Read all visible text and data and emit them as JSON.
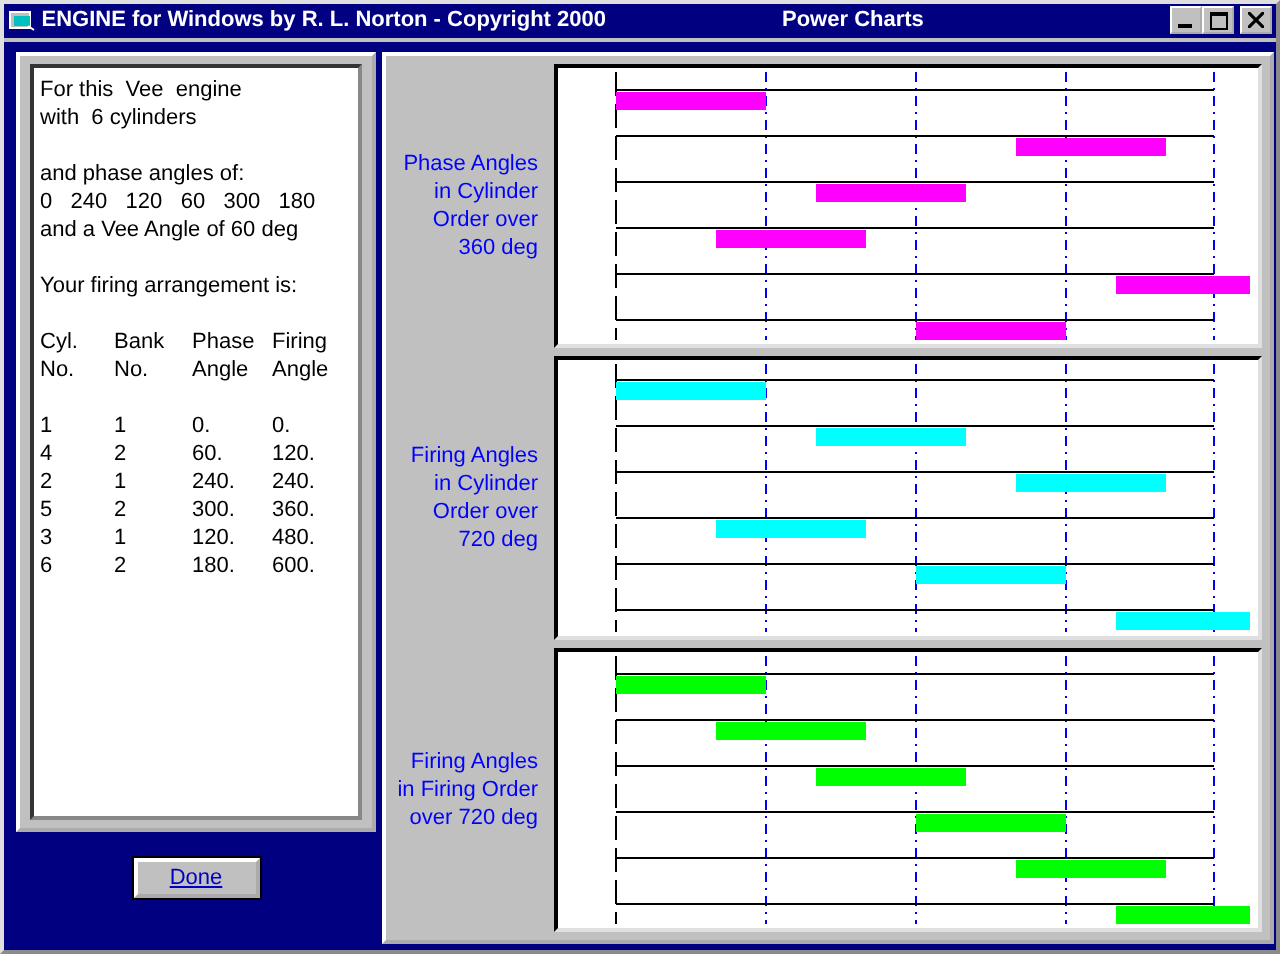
{
  "window": {
    "title": "ENGINE for Windows by R. L. Norton - Copyright 2000",
    "subtitle": "Power Charts"
  },
  "summary": {
    "paragraphs": [
      [
        "For this  Vee  engine",
        "with  6 cylinders"
      ],
      [
        "and phase angles of:",
        "0   240   120   60   300   180",
        "and a Vee Angle of 60 deg"
      ],
      [
        "Your firing arrangement is:"
      ]
    ],
    "header_rows": [
      [
        "Cyl.",
        "Bank",
        "Phase",
        "Firing"
      ],
      [
        "No.",
        "No.",
        "Angle",
        "Angle"
      ]
    ],
    "rows": [
      [
        "1",
        "1",
        "0.",
        "0."
      ],
      [
        "4",
        "2",
        "60.",
        "120."
      ],
      [
        "2",
        "1",
        "240.",
        "240."
      ],
      [
        "5",
        "2",
        "300.",
        "360."
      ],
      [
        "3",
        "1",
        "120.",
        "480."
      ],
      [
        "6",
        "2",
        "180.",
        "600."
      ]
    ]
  },
  "done_button": "Done",
  "charts": [
    {
      "label": [
        "Phase Angles",
        "in Cylinder",
        "Order over",
        "360 deg"
      ],
      "color": "#ff00ff"
    },
    {
      "label": [
        "Firing Angles",
        "in Cylinder",
        "Order over",
        "720 deg"
      ],
      "color": "#00ffff"
    },
    {
      "label": [
        "Firing Angles",
        "in Firing Order",
        "over 720 deg"
      ],
      "color": "#00ff00"
    }
  ]
}
